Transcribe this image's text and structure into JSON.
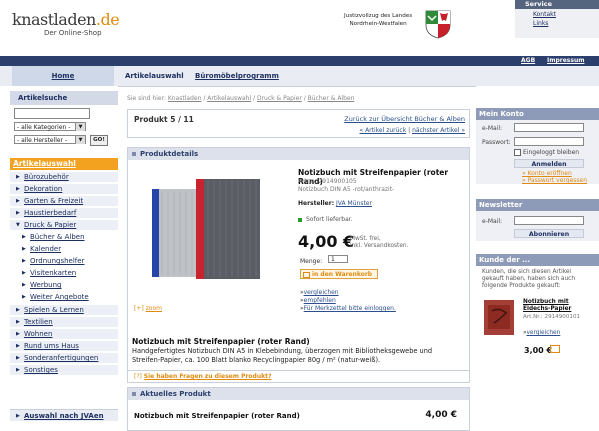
{
  "header": {
    "logo_main": "knastladen",
    "logo_tld": ".de",
    "logo_sub": "Der Online-Shop",
    "justiz_line1": "Justizvollzug des Landes",
    "justiz_line2": "Nordrhein-Westfalen",
    "service": {
      "title": "Service",
      "links": [
        "Kontakt",
        "Links"
      ]
    }
  },
  "topbar": {
    "agb": "AGB",
    "impressum": "Impressum"
  },
  "nav": {
    "home": "Home",
    "tabs": [
      "Artikelauswahl",
      "Büromöbelprogramm"
    ]
  },
  "search": {
    "title": "Artikelsuche",
    "category_select": "- alle Kategorien -",
    "maker_select": "- alle Hersteller -",
    "go": "GO!"
  },
  "categories": {
    "title": "Artikelauswahl",
    "items": [
      "Bürozubehör",
      "Dekoration",
      "Garten & Freizeit",
      "Haustierbedarf",
      "Druck & Papier"
    ],
    "sub_items": [
      "Bücher & Alben",
      "Kalender",
      "Ordnungshelfer",
      "Visitenkarten",
      "Werbung",
      "Weiter Angebote"
    ],
    "more_items": [
      "Spielen & Lernen",
      "Textilien",
      "Wohnen",
      "Rund ums Haus",
      "Sonderanfertigungen",
      "Sonstiges"
    ],
    "jva": "Auswahl nach JVAen"
  },
  "breadcrumb": {
    "prefix": "Sie sind hier:",
    "items": [
      "Knastladen",
      "Artikelauswahl",
      "Druck & Papier",
      "Bücher & Alben"
    ]
  },
  "pager": {
    "count": "Produkt 5 / 11",
    "back": "Zurück zur Übersicht Bücher & Alben",
    "prev": "« Artikel zurück",
    "sep": "|",
    "next": "nächster Artikel »"
  },
  "details": {
    "head": "Produktdetails",
    "name": "Notizbuch mit Streifenpapier (roter Rand)",
    "artnr": "Artnr.: 2914900105",
    "subtitle": "Notizbuch DIN A5 -rot/anthrazit-",
    "hersteller_label": "Hersteller:",
    "hersteller": "JVA Münster",
    "stock": "Sofort lieferbar.",
    "price": "4,00 €",
    "tax_line1": "MwSt. frei,",
    "tax_line2": "inkl. Versandkosten.",
    "qty_label": "Menge:",
    "qty_value": "1",
    "cart": "in den Warenkorb",
    "link_compare": "vergleichen",
    "link_recommend": "empfehlen",
    "link_note": "Für Merkzettel bitte einloggen.",
    "zoom": "zoom",
    "desc_title": "Notizbuch mit Streifenpapier (roter Rand)",
    "desc": "Handgefertigtes Notizbuch DIN A5 in Klebebindung, überzogen mit Bibliotheksgewebe und Streifen-Papier, ca. 100 Blatt blanko Recyclingpapier 80g / m²  (natur-weiß).",
    "question": "Sie haben Fragen zu diesem Produkt?"
  },
  "current": {
    "head": "Aktuelles Produkt",
    "name": "Notizbuch mit Streifenpapier (roter Rand)",
    "price": "4,00 €"
  },
  "account": {
    "title": "Mein Konto",
    "email_label": "e-Mail:",
    "password_label": "Passwort:",
    "remember": "Eingeloggt bleiben",
    "login": "Anmelden",
    "open_account": "Konto eröffnen",
    "forgot": "Passwort vergessen"
  },
  "newsletter": {
    "title": "Newsletter",
    "email_label": "e-Mail:",
    "subscribe": "Abonnieren"
  },
  "customers": {
    "title": "Kunde der ...",
    "text": "Kunden, die sich diesen Artikel gekauft haben, haben sich auch folgende Produkte gekauft:",
    "product_name": "Notizbuch mit Eidechs-Papier",
    "product_nr": "Art.Nr.: 2914900101",
    "compare": "vergleichen",
    "price": "3,00 €"
  },
  "colors": {
    "accent": "#f3a220",
    "brand": "#2c3f6c",
    "link": "#2a4f8c"
  }
}
